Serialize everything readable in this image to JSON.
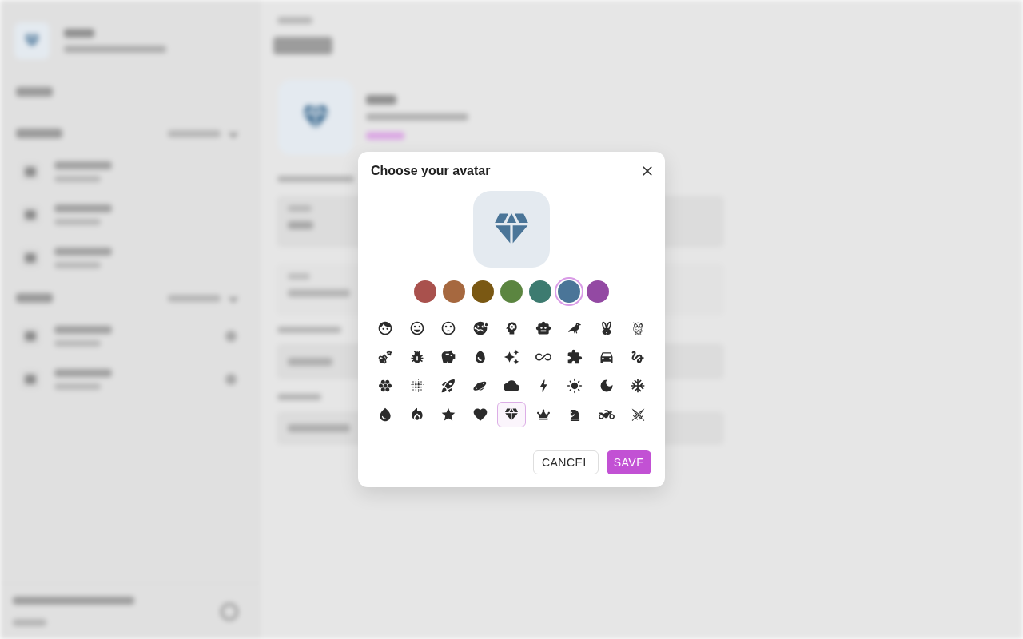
{
  "dialog": {
    "title": "Choose your avatar",
    "colors": [
      {
        "color": "#a9514d",
        "selected": false
      },
      {
        "color": "#a6683f",
        "selected": false
      },
      {
        "color": "#7a5813",
        "selected": false
      },
      {
        "color": "#5b8540",
        "selected": false
      },
      {
        "color": "#3d7b70",
        "selected": false
      },
      {
        "color": "#4a7598",
        "selected": true
      },
      {
        "color": "#9349a3",
        "selected": false
      }
    ],
    "icons": [
      {
        "selected": false
      },
      {
        "selected": false
      },
      {
        "selected": false
      },
      {
        "selected": false
      },
      {
        "selected": false
      },
      {
        "selected": false
      },
      {
        "selected": false
      },
      {
        "selected": false
      },
      {
        "selected": false
      },
      {
        "selected": false
      },
      {
        "selected": false
      },
      {
        "selected": false
      },
      {
        "selected": false
      },
      {
        "selected": false
      },
      {
        "selected": false
      },
      {
        "selected": false
      },
      {
        "selected": false
      },
      {
        "selected": false
      },
      {
        "selected": false
      },
      {
        "selected": false
      },
      {
        "selected": false
      },
      {
        "selected": false
      },
      {
        "selected": false
      },
      {
        "selected": false
      },
      {
        "selected": false
      },
      {
        "selected": false
      },
      {
        "selected": false
      },
      {
        "selected": false
      },
      {
        "selected": false
      },
      {
        "selected": false
      },
      {
        "selected": false
      },
      {
        "selected": true
      },
      {
        "selected": false
      },
      {
        "selected": false
      },
      {
        "selected": false
      },
      {
        "selected": false
      }
    ],
    "buttons": [
      {
        "label": "CANCEL",
        "kind": "outlined"
      },
      {
        "label": "SAVE",
        "kind": "filled"
      }
    ]
  }
}
